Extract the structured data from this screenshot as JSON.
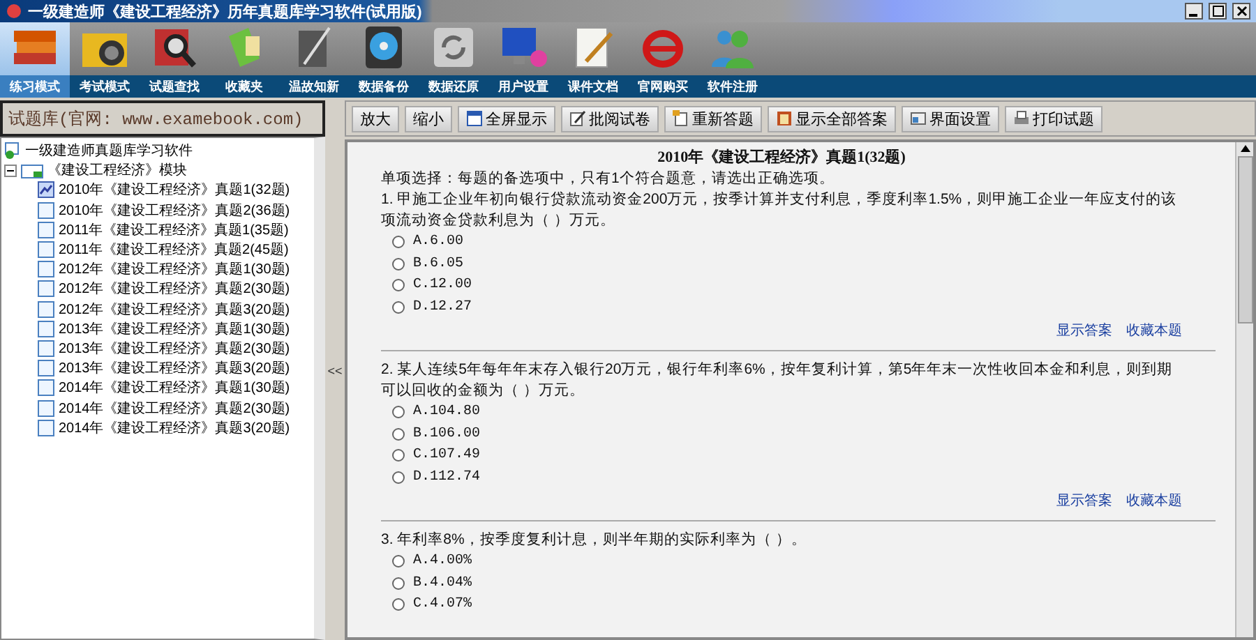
{
  "window": {
    "title": "一级建造师《建设工程经济》历年真题库学习软件(试用版)"
  },
  "toolbar": {
    "tools": [
      {
        "label": "练习模式",
        "kind": "books",
        "selected": true
      },
      {
        "label": "考试模式",
        "kind": "folder",
        "selected": false
      },
      {
        "label": "试题查找",
        "kind": "search",
        "selected": false
      },
      {
        "label": "收藏夹",
        "kind": "notebook",
        "selected": false
      },
      {
        "label": "温故知新",
        "kind": "pen",
        "selected": false
      },
      {
        "label": "数据备份",
        "kind": "disk",
        "selected": false
      },
      {
        "label": "数据还原",
        "kind": "restore",
        "selected": false
      },
      {
        "label": "用户设置",
        "kind": "monitor",
        "selected": false
      },
      {
        "label": "课件文档",
        "kind": "notepad",
        "selected": false
      },
      {
        "label": "官网购买",
        "kind": "browser",
        "selected": false
      },
      {
        "label": "软件注册",
        "kind": "users",
        "selected": false
      }
    ]
  },
  "sidebar": {
    "header": "试题库(官网: www.examebook.com)",
    "tree": {
      "label": "一级建造师真题库学习软件",
      "children": [
        {
          "label": "《建设工程经济》模块",
          "expanded": true,
          "children": [
            {
              "label": "2010年《建设工程经济》真题1(32题)",
              "selected": true
            },
            {
              "label": "2010年《建设工程经济》真题2(36题)",
              "selected": false
            },
            {
              "label": "2011年《建设工程经济》真题1(35题)",
              "selected": false
            },
            {
              "label": "2011年《建设工程经济》真题2(45题)",
              "selected": false
            },
            {
              "label": "2012年《建设工程经济》真题1(30题)",
              "selected": false
            },
            {
              "label": "2012年《建设工程经济》真题2(30题)",
              "selected": false
            },
            {
              "label": "2012年《建设工程经济》真题3(20题)",
              "selected": false
            },
            {
              "label": "2013年《建设工程经济》真题1(30题)",
              "selected": false
            },
            {
              "label": "2013年《建设工程经济》真题2(30题)",
              "selected": false
            },
            {
              "label": "2013年《建设工程经济》真题3(20题)",
              "selected": false
            },
            {
              "label": "2014年《建设工程经济》真题1(30题)",
              "selected": false
            },
            {
              "label": "2014年《建设工程经济》真题2(30题)",
              "selected": false
            },
            {
              "label": "2014年《建设工程经济》真题3(20题)",
              "selected": false
            }
          ]
        }
      ]
    }
  },
  "splitter": {
    "label": "<<"
  },
  "content_toolbar": {
    "buttons": [
      {
        "label": "放大",
        "kind": "plain"
      },
      {
        "label": "缩小",
        "kind": "plain"
      },
      {
        "label": "全屏显示",
        "kind": "fullscreen"
      },
      {
        "label": "批阅试卷",
        "kind": "review"
      },
      {
        "label": "重新答题",
        "kind": "redo"
      },
      {
        "label": "显示全部答案",
        "kind": "answers"
      },
      {
        "label": "界面设置",
        "kind": "settings"
      },
      {
        "label": "打印试题",
        "kind": "print"
      }
    ]
  },
  "document": {
    "title": "2010年《建设工程经济》真题1(32题)",
    "instruction": "单项选择：每题的备选项中，只有1个符合题意，请选出正确选项。",
    "questions": [
      {
        "text": "1. 甲施工企业年初向银行贷款流动资金200万元，按季计算并支付利息，季度利率1.5%，则甲施工企业一年应支付的该项流动资金贷款利息为（ ）万元。",
        "options": [
          {
            "label": "A.6.00",
            "selected": false
          },
          {
            "label": "B.6.05",
            "selected": false
          },
          {
            "label": "C.12.00",
            "selected": false
          },
          {
            "label": "D.12.27",
            "selected": false
          }
        ],
        "actions": [
          "显示答案",
          "收藏本题"
        ]
      },
      {
        "text": "2. 某人连续5年每年年末存入银行20万元，银行年利率6%，按年复利计算，第5年年末一次性收回本金和利息，则到期可以回收的金额为（ ）万元。",
        "options": [
          {
            "label": "A.104.80",
            "selected": false
          },
          {
            "label": "B.106.00",
            "selected": false
          },
          {
            "label": "C.107.49",
            "selected": false
          },
          {
            "label": "D.112.74",
            "selected": false
          }
        ],
        "actions": [
          "显示答案",
          "收藏本题"
        ]
      },
      {
        "text": "3. 年利率8%，按季度复利计息，则半年期的实际利率为（ ）。",
        "options": [
          {
            "label": "A.4.00%",
            "selected": false
          },
          {
            "label": "B.4.04%",
            "selected": false
          },
          {
            "label": "C.4.07%",
            "selected": false
          }
        ]
      }
    ]
  }
}
